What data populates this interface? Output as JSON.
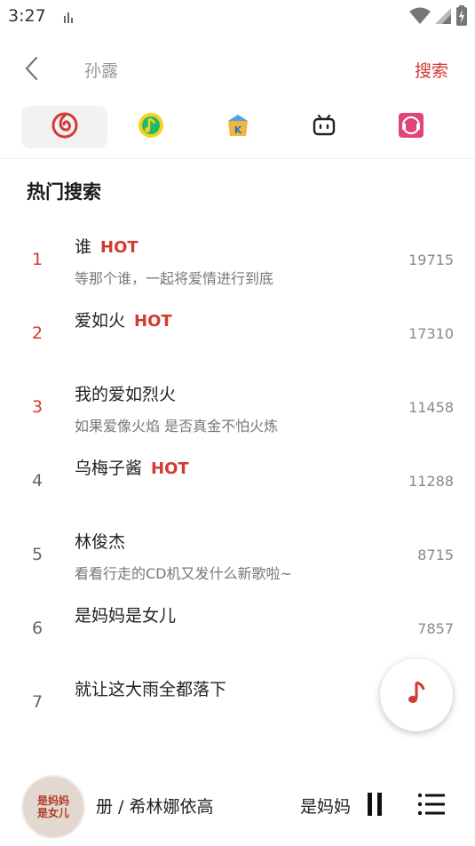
{
  "status": {
    "time": "3:27"
  },
  "search": {
    "query": "孙露",
    "button_label": "搜索"
  },
  "sources": [
    {
      "icon": "netease-music-icon",
      "active": true
    },
    {
      "icon": "qq-music-icon",
      "active": false
    },
    {
      "icon": "kugou-icon",
      "active": false
    },
    {
      "icon": "bilibili-icon",
      "active": false
    },
    {
      "icon": "migu-music-icon",
      "active": false
    }
  ],
  "hot_section": {
    "title": "热门搜索",
    "hot_badge": "HOT",
    "items": [
      {
        "rank": "1",
        "title": "谁",
        "hot": true,
        "desc": "等那个谁，一起将爱情进行到底",
        "count": "19715"
      },
      {
        "rank": "2",
        "title": "爱如火",
        "hot": true,
        "desc": "",
        "count": "17310"
      },
      {
        "rank": "3",
        "title": "我的爱如烈火",
        "hot": false,
        "desc": "如果爱像火焰 是否真金不怕火炼",
        "count": "11458"
      },
      {
        "rank": "4",
        "title": "乌梅子酱",
        "hot": true,
        "desc": "",
        "count": "11288"
      },
      {
        "rank": "5",
        "title": "林俊杰",
        "hot": false,
        "desc": "看看行走的CD机又发什么新歌啦~",
        "count": "8715"
      },
      {
        "rank": "6",
        "title": "是妈妈是女儿",
        "hot": false,
        "desc": "",
        "count": "7857"
      },
      {
        "rank": "7",
        "title": "就让这大雨全都落下",
        "hot": false,
        "desc": "",
        "count": ""
      }
    ]
  },
  "player": {
    "artist": "册 / 希林娜依高",
    "title": "是妈妈",
    "cover_text_1": "是妈妈",
    "cover_text_2": "是女儿"
  }
}
